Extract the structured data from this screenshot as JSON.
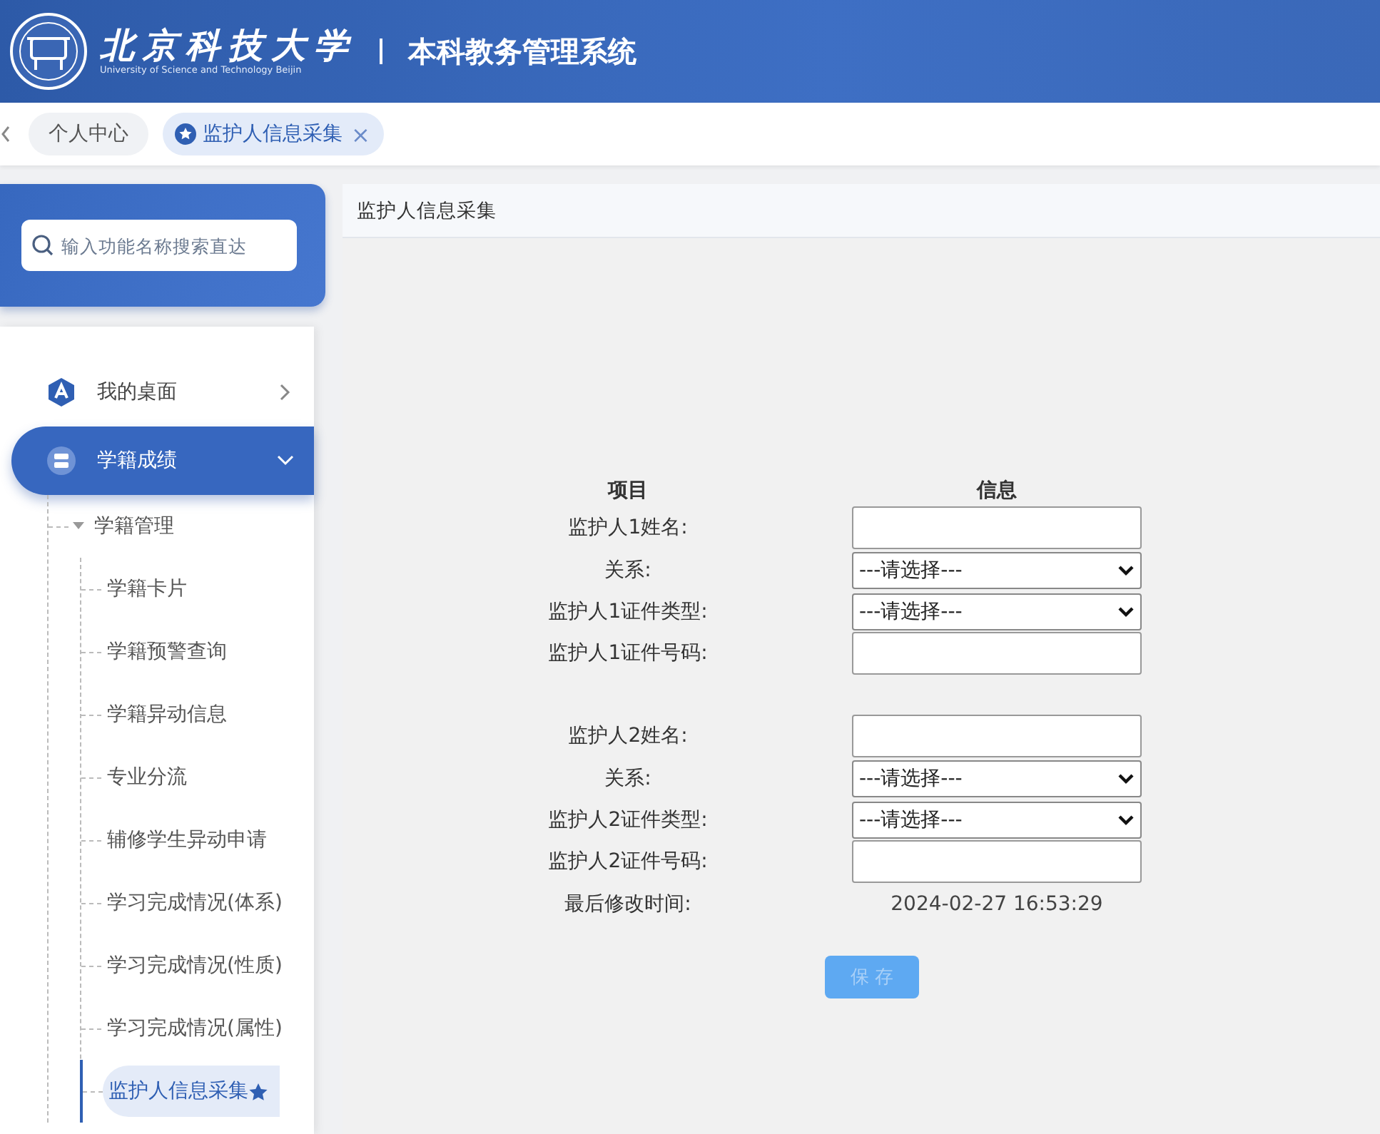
{
  "header": {
    "school_name": "北京科技大学",
    "school_name_en": "University of Science and Technology Beijin",
    "system_title": "本科教务管理系统"
  },
  "tabs": [
    {
      "label": "个人中心",
      "selected": false
    },
    {
      "label": "监护人信息采集",
      "selected": true,
      "close": "×"
    }
  ],
  "sidebar": {
    "search": {
      "placeholder": "输入功能名称搜索直达"
    },
    "items": [
      {
        "label": "我的桌面",
        "selected": false,
        "expanded": false
      },
      {
        "label": "学籍成绩",
        "selected": true,
        "expanded": true,
        "children": [
          {
            "label": "学籍管理",
            "expanded": true,
            "children": [
              {
                "label": "学籍卡片",
                "selected": false
              },
              {
                "label": "学籍预警查询",
                "selected": false
              },
              {
                "label": "学籍异动信息",
                "selected": false
              },
              {
                "label": "专业分流",
                "selected": false
              },
              {
                "label": "辅修学生异动申请",
                "selected": false
              },
              {
                "label": "学习完成情况(体系)",
                "selected": false
              },
              {
                "label": "学习完成情况(性质)",
                "selected": false
              },
              {
                "label": "学习完成情况(属性)",
                "selected": false
              },
              {
                "label": "监护人信息采集",
                "selected": true,
                "starred": true
              }
            ]
          }
        ]
      }
    ]
  },
  "content": {
    "title": "监护人信息采集",
    "form": {
      "columns": [
        "项目",
        "信息"
      ],
      "rows": [
        {
          "kind": "input",
          "label": "监护人1姓名:"
        },
        {
          "kind": "select",
          "label": "关系:",
          "value": "---请选择---"
        },
        {
          "kind": "select",
          "label": "监护人1证件类型:",
          "value": "---请选择---"
        },
        {
          "kind": "input",
          "label": "监护人1证件号码:"
        },
        {
          "kind": "spacer"
        },
        {
          "kind": "input",
          "label": "监护人2姓名:"
        },
        {
          "kind": "select",
          "label": "关系:",
          "value": "---请选择---"
        },
        {
          "kind": "select",
          "label": "监护人2证件类型:",
          "value": "---请选择---"
        },
        {
          "kind": "input",
          "label": "监护人2证件号码:"
        },
        {
          "kind": "static",
          "label": "最后修改时间:",
          "value": "2024-02-27 16:53:29"
        }
      ],
      "save_button": {
        "label": "保 存",
        "disabled": true
      }
    }
  }
}
